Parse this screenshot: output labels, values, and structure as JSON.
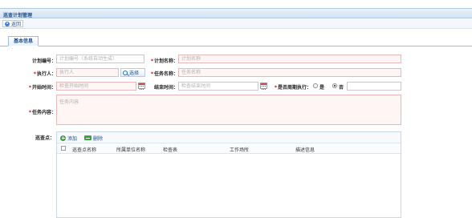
{
  "window": {
    "title": "巡查计划管理"
  },
  "toolbar": {
    "back_label": "返回"
  },
  "tabs": [
    {
      "label": "基本信息"
    }
  ],
  "form": {
    "plan_no": {
      "label": "计划编号：",
      "placeholder": "计划编号（系统自动生成）"
    },
    "plan_name": {
      "label": "计划名称：",
      "placeholder": "计划名称"
    },
    "executor": {
      "label": "执行人：",
      "placeholder": "执行人",
      "select_label": "选择"
    },
    "task_name": {
      "label": "任务名称：",
      "placeholder": "任务名称"
    },
    "start_time": {
      "label": "开始时间：",
      "placeholder": "检查开始时间"
    },
    "end_time": {
      "label": "结束时间：",
      "placeholder": "检查结束时间"
    },
    "periodic": {
      "label": "是否周期执行：",
      "options": [
        "是",
        "否"
      ],
      "selected": "否"
    },
    "task_content": {
      "label": "任务内容：",
      "placeholder": "任务内容"
    },
    "checkpoints": {
      "label": "巡查点："
    }
  },
  "grid": {
    "add_label": "添加",
    "delete_label": "删除",
    "columns": [
      "巡查点名称",
      "所属单位名称",
      "检查表",
      "工作场所",
      "描述信息"
    ]
  },
  "colors": {
    "required_field_bg": "#fff5f5",
    "header_bg": "#d3e3f4",
    "accent": "#1e4e8a"
  }
}
